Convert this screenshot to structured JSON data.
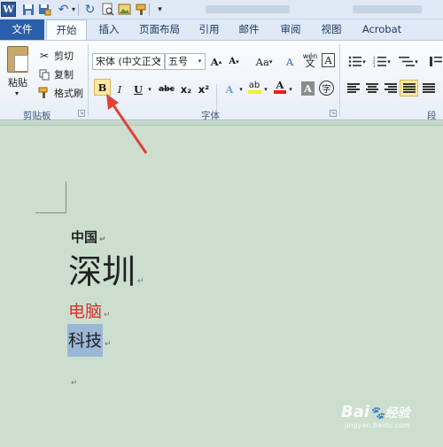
{
  "app": {
    "icon_letter": "W"
  },
  "tabs": [
    "文件",
    "开始",
    "插入",
    "页面布局",
    "引用",
    "邮件",
    "审阅",
    "视图",
    "Acrobat"
  ],
  "clipboard": {
    "paste_label": "粘贴",
    "cut_label": "剪切",
    "copy_label": "复制",
    "format_painter_label": "格式刷",
    "group_label": "剪贴板"
  },
  "font_group": {
    "font_name": "宋体 (中文正文",
    "font_size": "五号",
    "group_label": "字体",
    "bold": "B",
    "italic": "I",
    "underline": "U",
    "strike": "abc",
    "subscript": "x₂",
    "superscript": "x²",
    "grow": "A",
    "shrink": "A",
    "change_case": "Aa",
    "clear_format": "A",
    "phonetic": "wén",
    "border_char": "A",
    "text_effect": "A",
    "highlight": "ab",
    "font_color": "A",
    "char_shading": "A",
    "enclose": "字"
  },
  "paragraph_group": {
    "group_label": "段落"
  },
  "document": {
    "line1": "中国",
    "line2": "深圳",
    "line3": "电脑",
    "line4": "科技",
    "paragraph_mark": "↵"
  },
  "colors": {
    "accent": "#2b5fab",
    "doc_background": "#ccdfcf",
    "line3_color": "#d0312d",
    "highlight_selection": "#9ab8d6",
    "arrow": "#e0413a"
  },
  "watermark": {
    "brand": "Bai",
    "brand2": "经验",
    "sub": "jingyan.baidu.com"
  }
}
